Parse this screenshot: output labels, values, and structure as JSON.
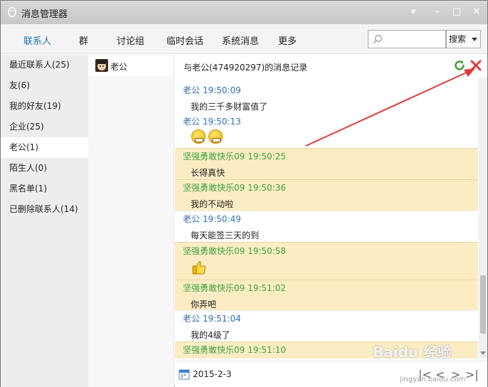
{
  "window": {
    "title": "消息管理器",
    "controls": {
      "menu": "▾",
      "minimize": "–",
      "maximize": "□",
      "close": "✕"
    }
  },
  "tabs": [
    {
      "label": "联系人",
      "active": true
    },
    {
      "label": "群"
    },
    {
      "label": "讨论组"
    },
    {
      "label": "临时会话"
    },
    {
      "label": "系统消息"
    },
    {
      "label": "更多"
    }
  ],
  "search": {
    "placeholder": "",
    "button_label": "搜索"
  },
  "sidebar": {
    "items": [
      {
        "label": "最近联系人(25)"
      },
      {
        "label": "友(6)"
      },
      {
        "label": "我的好友(19)"
      },
      {
        "label": "企业(25)"
      },
      {
        "label": "老公(1)",
        "selected": true
      },
      {
        "label": "陌生人(0)"
      },
      {
        "label": "黑名单(1)"
      },
      {
        "label": "已删除联系人(14)"
      }
    ]
  },
  "contacts": [
    {
      "name": "老公"
    }
  ],
  "chat": {
    "title": "与老公(474920297)的消息记录",
    "messages": [
      {
        "sender": "老公",
        "time": "19:50:09",
        "text": "我的三千多财富值了",
        "mine": false
      },
      {
        "sender": "老公",
        "time": "19:50:13",
        "text": "",
        "emoji": "grin-grin",
        "mine": false
      },
      {
        "sender": "坚强勇敢快乐09",
        "time": "19:50:25",
        "text": "长得真快",
        "mine": true
      },
      {
        "sender": "坚强勇敢快乐09",
        "time": "19:50:36",
        "text": "我的不动啦",
        "mine": true
      },
      {
        "sender": "老公",
        "time": "19:50:49",
        "text": "每天能签三天的到",
        "mine": false
      },
      {
        "sender": "坚强勇敢快乐09",
        "time": "19:50:58",
        "text": "",
        "emoji": "thumbs-up",
        "mine": true
      },
      {
        "sender": "坚强勇敢快乐09",
        "time": "19:51:02",
        "text": "你弄吧",
        "mine": true
      },
      {
        "sender": "老公",
        "time": "19:51:04",
        "text": "我的4级了",
        "mine": false
      },
      {
        "sender": "坚强勇敢快乐09",
        "time": "19:51:10",
        "text": "",
        "mine": true
      }
    ],
    "footer_date": "2015-2-3"
  },
  "watermark": {
    "logo": "Baidu 经验",
    "url": "jingyan.baidu.com"
  },
  "colors": {
    "accent_blue": "#1c6fb7",
    "peer_name": "#2f6fb0",
    "self_name": "#3aa346",
    "self_bg": "#fbecc3",
    "annotation_red": "#e03a3a"
  }
}
